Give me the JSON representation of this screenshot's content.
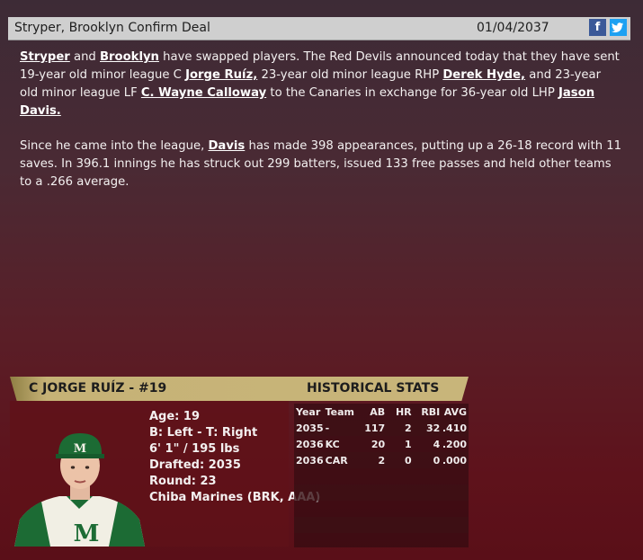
{
  "header": {
    "title": "Stryper, Brooklyn Confirm Deal",
    "date": "01/04/2037",
    "facebook_label": "f",
    "twitter_label": "t"
  },
  "article": {
    "p1": {
      "link_stryper": "Stryper",
      "t1": " and ",
      "link_brooklyn": "Brooklyn",
      "t2": " have swapped players. The Red Devils announced today that they have sent 19-year old minor league C ",
      "link_ruiz": "Jorge Ruíz,",
      "t3": " 23-year old minor league RHP ",
      "link_hyde": "Derek Hyde,",
      "t4": " and 23-year old minor league LF ",
      "link_calloway": "C. Wayne Calloway",
      "t5": " to the Canaries in exchange for 36-year old LHP ",
      "link_davis": "Jason Davis.",
      "t6": ""
    },
    "p2": {
      "t1": "Since he came into the league, ",
      "link_davis": "Davis",
      "t2": " has made 398 appearances, putting up a 26-18 record with 11 saves. In 396.1 innings he has struck out 299 batters, issued 133 free passes and held other teams to a .266 average."
    }
  },
  "player_card": {
    "name": "C JORGE RUÍZ - #19",
    "historical_label": "HISTORICAL STATS",
    "info": [
      "Age: 19",
      "B: Left - T: Right",
      "6' 1\" / 195 lbs",
      "Drafted: 2035",
      "Round: 23",
      "Chiba Marines (BRK, AAA)"
    ],
    "stats_headers": [
      "Year",
      "Team",
      "AB",
      "HR",
      "RBI",
      "AVG"
    ],
    "stats_rows": [
      [
        "2035",
        "-",
        "117",
        "2",
        "32",
        ".410"
      ],
      [
        "2036",
        "KC",
        "20",
        "1",
        "4",
        ".200"
      ],
      [
        "2036",
        "CAR",
        "2",
        "0",
        "0",
        ".000"
      ]
    ]
  },
  "colors": {
    "header_bg": "#cfcfcf",
    "card_gold": "#c8b57a",
    "facebook": "#3b5998",
    "twitter": "#1da1f2"
  }
}
